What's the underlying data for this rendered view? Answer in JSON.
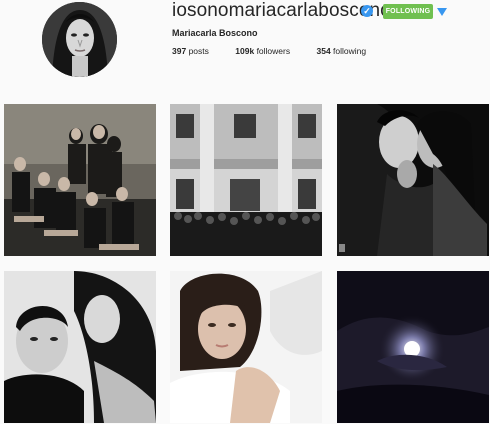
{
  "profile": {
    "username": "iosonomariacarlaboscono",
    "verified_glyph": "✓",
    "follow_label": "FOLLOWING",
    "full_name": "Mariacarla Boscono",
    "stats": {
      "posts_count": "397",
      "posts_label": "posts",
      "followers_count": "109k",
      "followers_label": "followers",
      "following_count": "354",
      "following_label": "following"
    }
  },
  "colors": {
    "following_button": "#70c050",
    "verified_badge": "#3897f0",
    "background": "#fafafa"
  },
  "icons": [
    "verified-badge-icon",
    "dropdown-arrow-icon"
  ],
  "posts": [
    {
      "subject": "group-of-dancers-photo"
    },
    {
      "subject": "crowd-at-building-photo"
    },
    {
      "subject": "couple-kissing-photo"
    },
    {
      "subject": "couple-portrait-photo"
    },
    {
      "subject": "selfie-in-bed-photo"
    },
    {
      "subject": "moon-night-sky-photo"
    }
  ]
}
